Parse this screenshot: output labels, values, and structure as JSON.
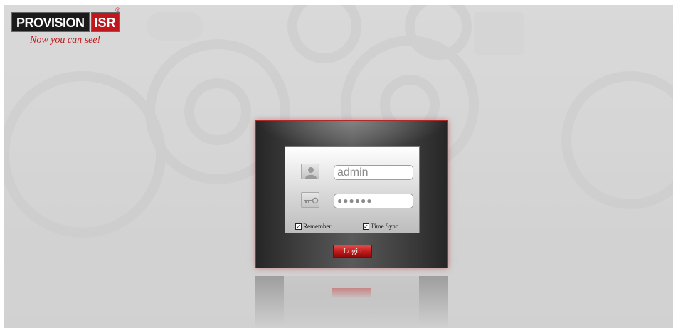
{
  "brand": {
    "name": "PROVISION",
    "suffix": "ISR",
    "registered_mark": "®",
    "tagline": "Now you can see!"
  },
  "login": {
    "username_value": "admin",
    "password_value": "●●●●●●",
    "remember_label": "Remember",
    "remember_checked": true,
    "time_sync_label": "Time Sync",
    "time_sync_checked": true,
    "login_label": "Login"
  },
  "icons": {
    "user": "user-icon",
    "password": "key-icon",
    "checkbox": "checkmark-icon"
  },
  "colors": {
    "brand_red": "#c0171c",
    "panel_border": "#b02a2a",
    "background": "#d6d6d6"
  }
}
